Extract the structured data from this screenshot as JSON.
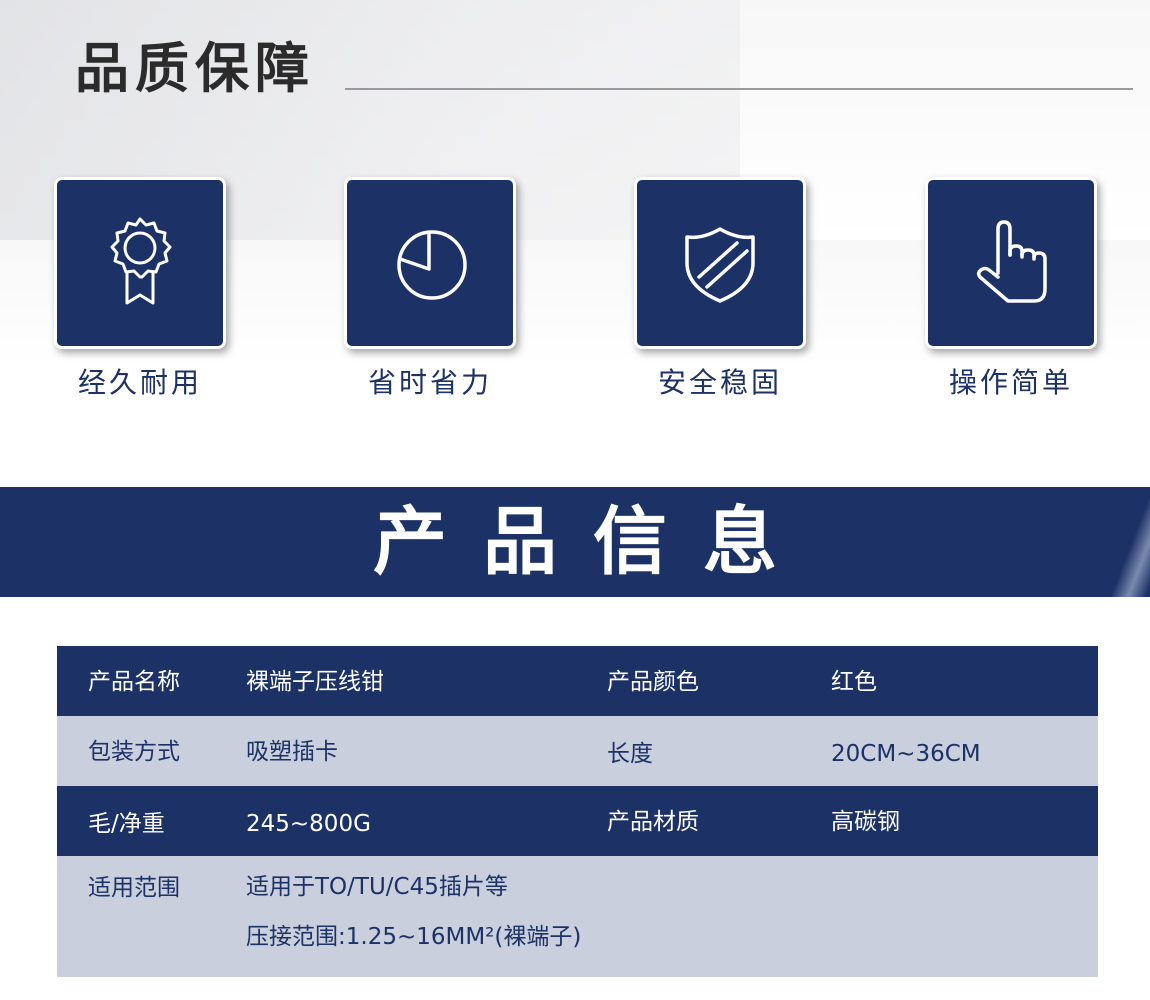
{
  "quality": {
    "title": "品质保障",
    "features": [
      {
        "label": "经久耐用",
        "icon": "award-badge-icon"
      },
      {
        "label": "省时省力",
        "icon": "clock-icon"
      },
      {
        "label": "安全稳固",
        "icon": "shield-icon"
      },
      {
        "label": "操作简单",
        "icon": "pointing-hand-icon"
      }
    ]
  },
  "banner": {
    "title": "产品信息"
  },
  "specs": {
    "rows": [
      {
        "k1": "产品名称",
        "v1": "裸端子压线钳",
        "k2": "产品颜色",
        "v2": "红色"
      },
      {
        "k1": "包装方式",
        "v1": "吸塑插卡",
        "k2": "长度",
        "v2": "20CM~36CM"
      },
      {
        "k1": "毛/净重",
        "v1": "245~800G",
        "k2": "产品材质",
        "v2": "高碳钢"
      },
      {
        "k1": "适用范围",
        "v1_lines": [
          "适用于TO/TU/C45插片等",
          "压接范围:1.25~16MM²(裸端子)"
        ]
      }
    ]
  },
  "colors": {
    "navy": "#1c3166",
    "light_row": "#c9cfdd",
    "white": "#ffffff"
  }
}
